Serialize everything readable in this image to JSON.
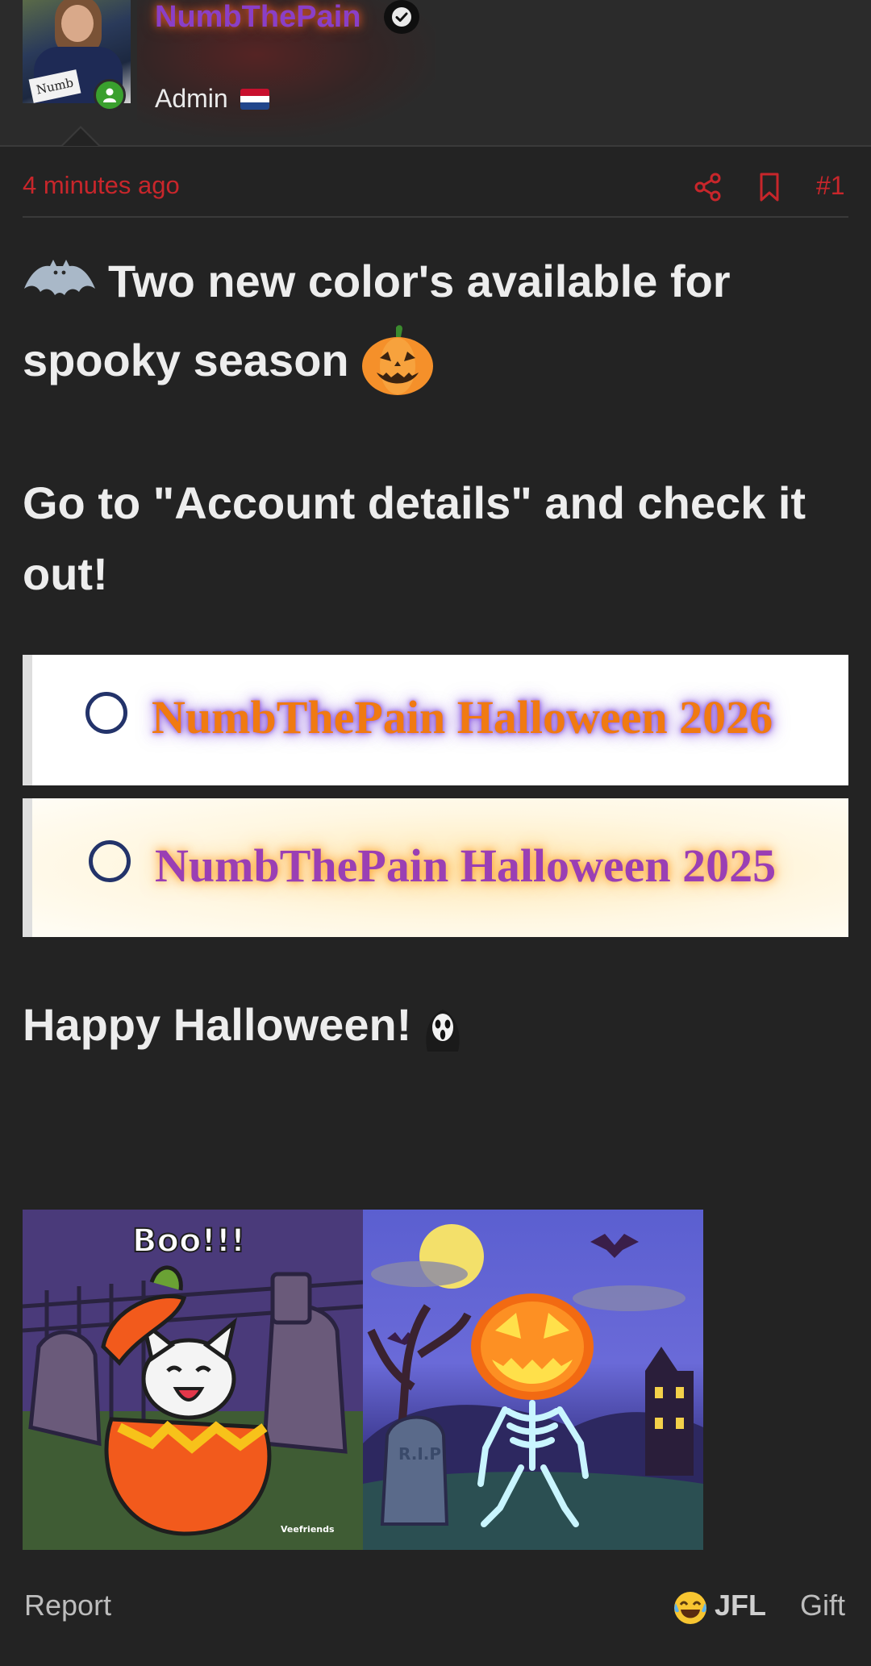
{
  "author": {
    "username": "NumbThePain",
    "role": "Admin",
    "avatar_text": "Numb",
    "colors": {
      "username": "#8a3fc7",
      "glow": "#e65a28",
      "online": "#3aa02e"
    }
  },
  "post_meta": {
    "timestamp": "4 minutes ago",
    "post_number": "#1",
    "accent_color": "#c8262b",
    "icons": [
      "share-icon",
      "bookmark-icon"
    ]
  },
  "content": {
    "headline": "Two new color's available for spooky season",
    "body": "Go to \"Account details\" and check it out!",
    "options": [
      {
        "label": "NumbThePain Halloween 2026",
        "selected": false
      },
      {
        "label": "NumbThePain Halloween 2025",
        "selected": false
      }
    ],
    "greeting": "Happy Halloween!",
    "gifs": [
      {
        "caption": "Boo!!!",
        "watermark": "Veefriends"
      },
      {
        "tombstone_text": "R.I.P"
      }
    ]
  },
  "footer": {
    "report_label": "Report",
    "reaction_label": "JFL",
    "gift_label": "Gift"
  }
}
